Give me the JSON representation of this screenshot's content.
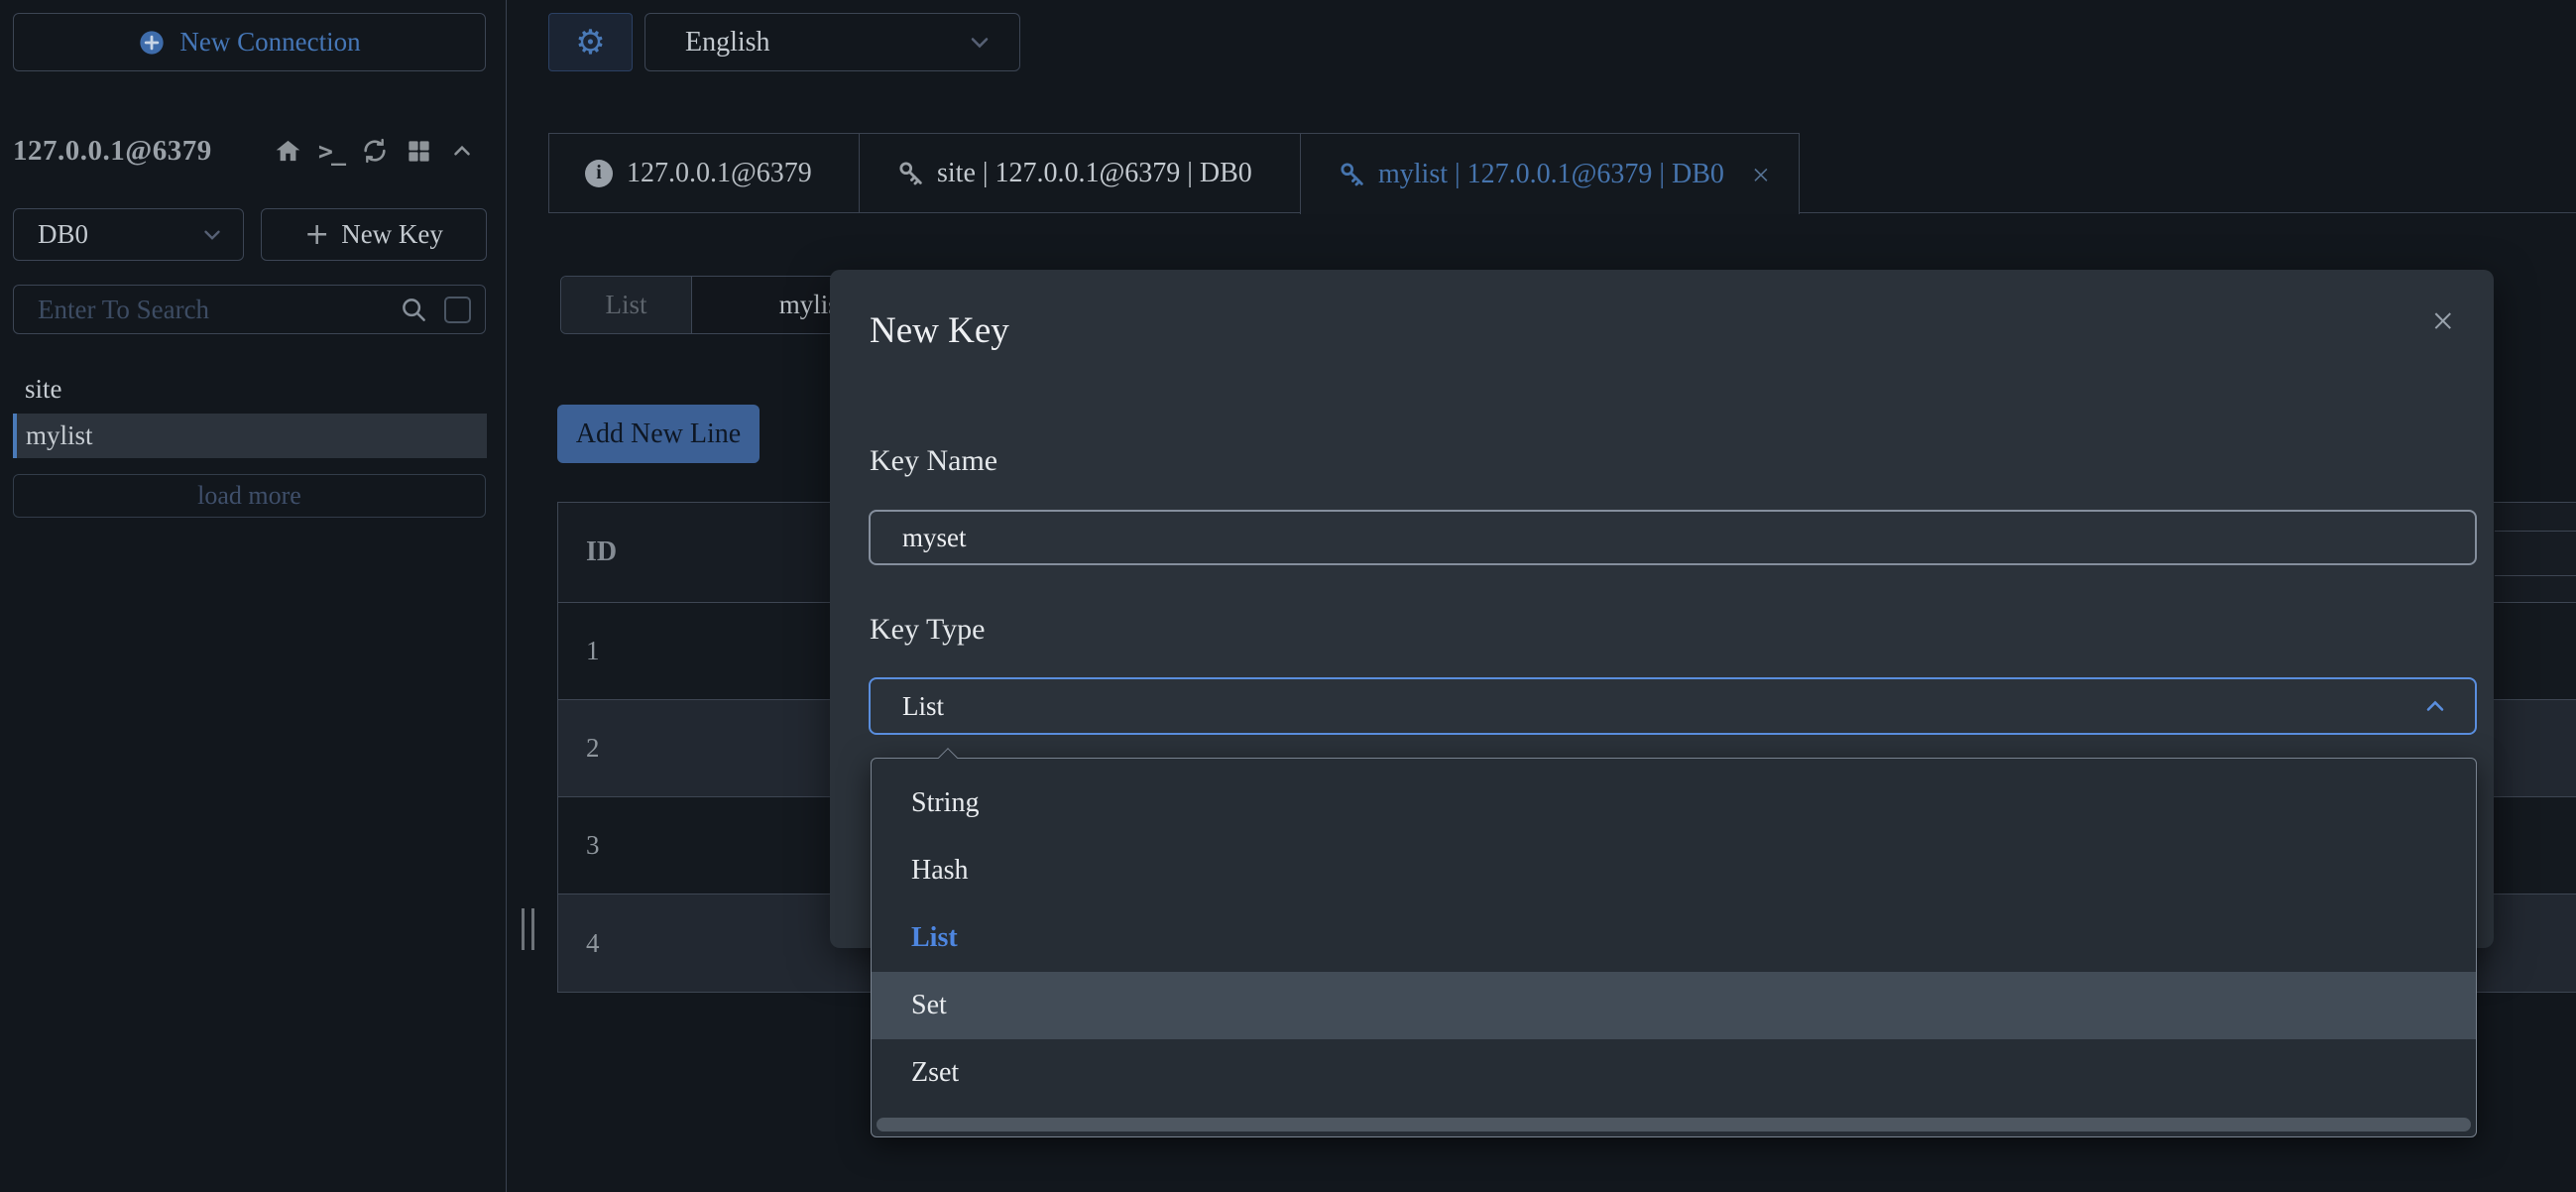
{
  "colors": {
    "page_bg": "#12171d",
    "accent_blue": "#4a7ab8",
    "select_active_border": "#5a8ede",
    "option_selected_blue": "#4e86e0",
    "modal_bg": "#2b323a",
    "button_blue_bg": "#3c6095",
    "row_stripe_dark": "#14191f",
    "row_stripe_light": "#222831",
    "border": "#3e4653"
  },
  "icons": {
    "gear_glyph": "⚙",
    "plus_glyph": "+",
    "terminal_glyph": ">_",
    "close_glyph": "×",
    "info_glyph": "i"
  },
  "sidebar": {
    "new_connection_label": "New Connection",
    "connection_name": "127.0.0.1@6379",
    "db_select_value": "DB0",
    "new_key_label": "New Key",
    "search": {
      "placeholder": "Enter To Search"
    },
    "keys": [
      {
        "label": "site"
      },
      {
        "label": "mylist"
      }
    ],
    "load_more_label": "load more"
  },
  "topbar": {
    "language_value": "English"
  },
  "tabs": [
    {
      "label": "127.0.0.1@6379"
    },
    {
      "label": "site | 127.0.0.1@6379 | DB0"
    },
    {
      "label": "mylist | 127.0.0.1@6379 | DB0"
    }
  ],
  "content": {
    "type_tag": "List",
    "key_label": "mylist",
    "add_new_line_label": "Add New Line",
    "table": {
      "header": "ID",
      "rows": [
        "1",
        "2",
        "3",
        "4"
      ]
    }
  },
  "modal": {
    "title": "New Key",
    "key_name_label": "Key Name",
    "key_name_value": "myset",
    "key_type_label": "Key Type",
    "key_type_value": "List",
    "options": [
      {
        "label": "String"
      },
      {
        "label": "Hash"
      },
      {
        "label": "List"
      },
      {
        "label": "Set"
      },
      {
        "label": "Zset"
      }
    ]
  }
}
